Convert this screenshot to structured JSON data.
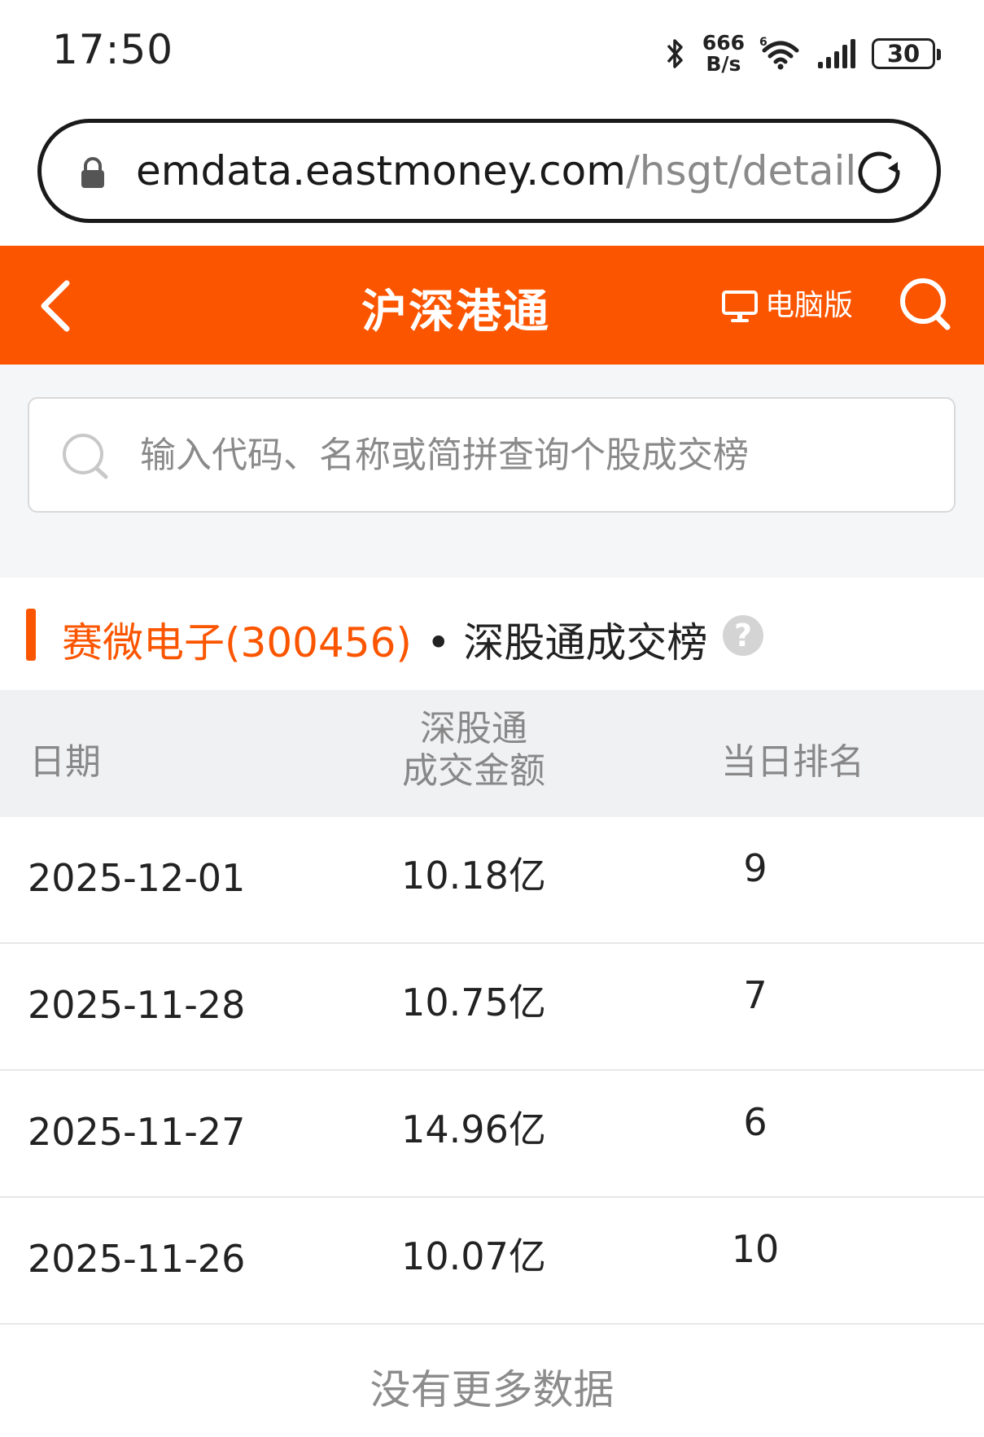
{
  "status_bar": {
    "time": "17:50",
    "net_speed_value": "666",
    "net_speed_unit": "B/s",
    "wifi_badge": "6",
    "battery": "30",
    "icons": [
      "bluetooth-icon",
      "wifi-icon",
      "signal-icon",
      "battery-icon"
    ]
  },
  "browser": {
    "url_domain": "emdata.eastmoney.com",
    "url_path": "/hsgt/detail."
  },
  "header": {
    "title": "沪深港通",
    "pc_version_label": "电脑版"
  },
  "search": {
    "placeholder": "输入代码、名称或简拼查询个股成交榜",
    "value": ""
  },
  "section": {
    "stock": "赛微电子(300456)",
    "subtitle": "• 深股通成交榜",
    "help": "?"
  },
  "table": {
    "headers": {
      "date": "日期",
      "amount_line1": "深股通",
      "amount_line2": "成交金额",
      "rank": "当日排名"
    },
    "rows": [
      {
        "date": "2025-12-01",
        "amount": "10.18亿",
        "rank": "9"
      },
      {
        "date": "2025-11-28",
        "amount": "10.75亿",
        "rank": "7"
      },
      {
        "date": "2025-11-27",
        "amount": "14.96亿",
        "rank": "6"
      },
      {
        "date": "2025-11-26",
        "amount": "10.07亿",
        "rank": "10"
      }
    ],
    "footer": "没有更多数据"
  },
  "colors": {
    "accent": "#fb5500",
    "page_bg": "#f5f6f8"
  }
}
